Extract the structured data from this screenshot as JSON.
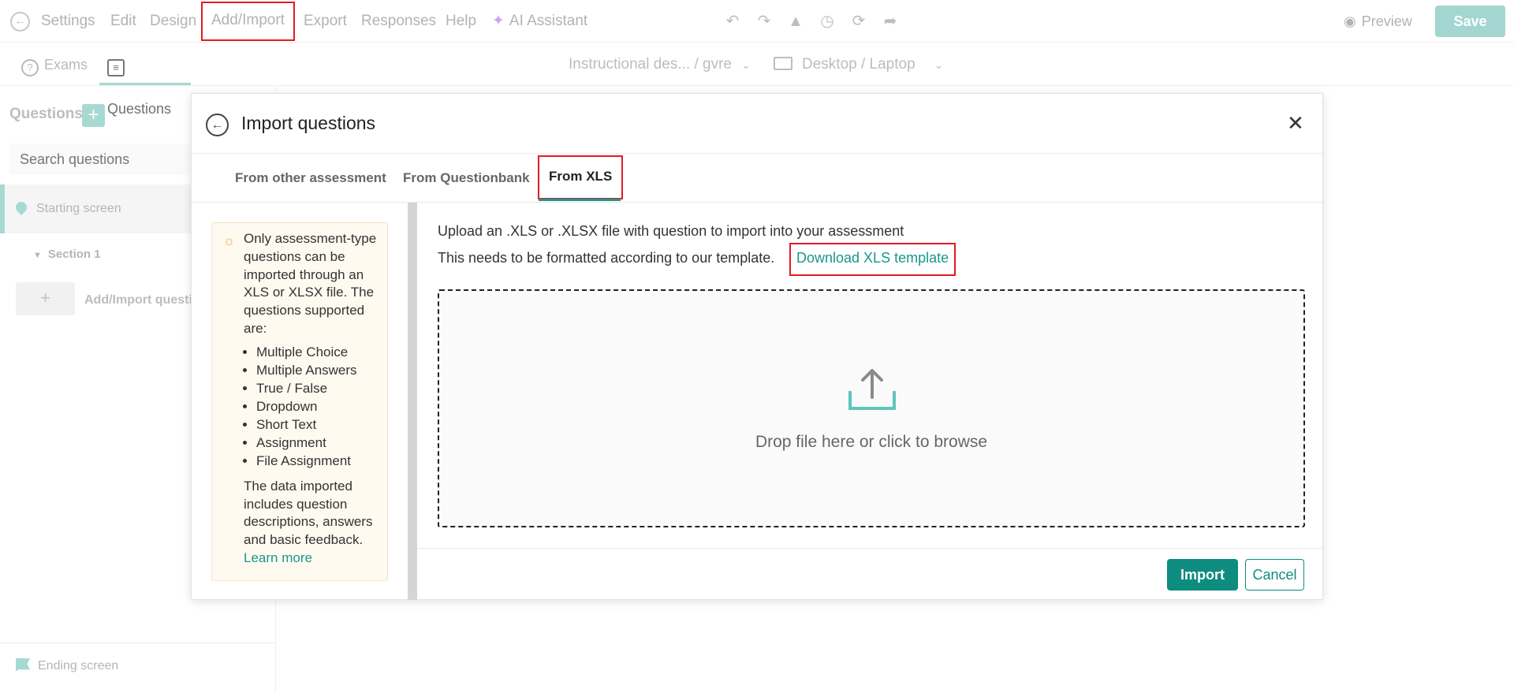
{
  "menu": {
    "settings": "Settings",
    "edit": "Edit",
    "design": "Design",
    "add_import": "Add/Import",
    "export": "Export",
    "responses": "Responses",
    "help": "Help",
    "ai_assistant": "AI Assistant"
  },
  "toolbar": {
    "icons": [
      "undo-icon",
      "redo-icon",
      "graduation-cap-icon",
      "clock-icon",
      "refresh-icon",
      "share-icon"
    ],
    "preview_label": "Preview",
    "save_label": "Save"
  },
  "subnav": {
    "exams_tab": "Exams",
    "questions_tab": "Questions",
    "assessment_selector": "Instructional des... / gvre",
    "device_selector": "Desktop / Laptop"
  },
  "sidebar": {
    "title": "Questions",
    "search_placeholder": "Search questions",
    "starting_screen": "Starting screen",
    "section": "Section 1",
    "add_import_label": "Add/Import questions",
    "ending_screen": "Ending screen"
  },
  "modal": {
    "title": "Import questions",
    "tabs": [
      "From other assessment",
      "From Questionbank",
      "From XLS"
    ],
    "active_tab": "From XLS",
    "info": {
      "intro": "Only assessment-type questions can be imported through an XLS or XLSX file. The questions supported are:",
      "types": [
        "Multiple Choice",
        "Multiple Answers",
        "True / False",
        "Dropdown",
        "Short Text",
        "Assignment",
        "File Assignment"
      ],
      "outro": "The data imported includes question descriptions, answers and basic feedback.",
      "learn_more": "Learn more"
    },
    "upload_line1": "Upload an .XLS or .XLSX file with question to import into your assessment",
    "upload_line2": "This needs to be formatted according to our template.",
    "download_link": "Download XLS template",
    "dropzone_text": "Drop file here or click to browse",
    "import_button": "Import",
    "cancel_button": "Cancel"
  },
  "colors": {
    "accent": "#0e8c7f",
    "accent_light": "#a7d9d3",
    "highlight": "#e21b23"
  }
}
